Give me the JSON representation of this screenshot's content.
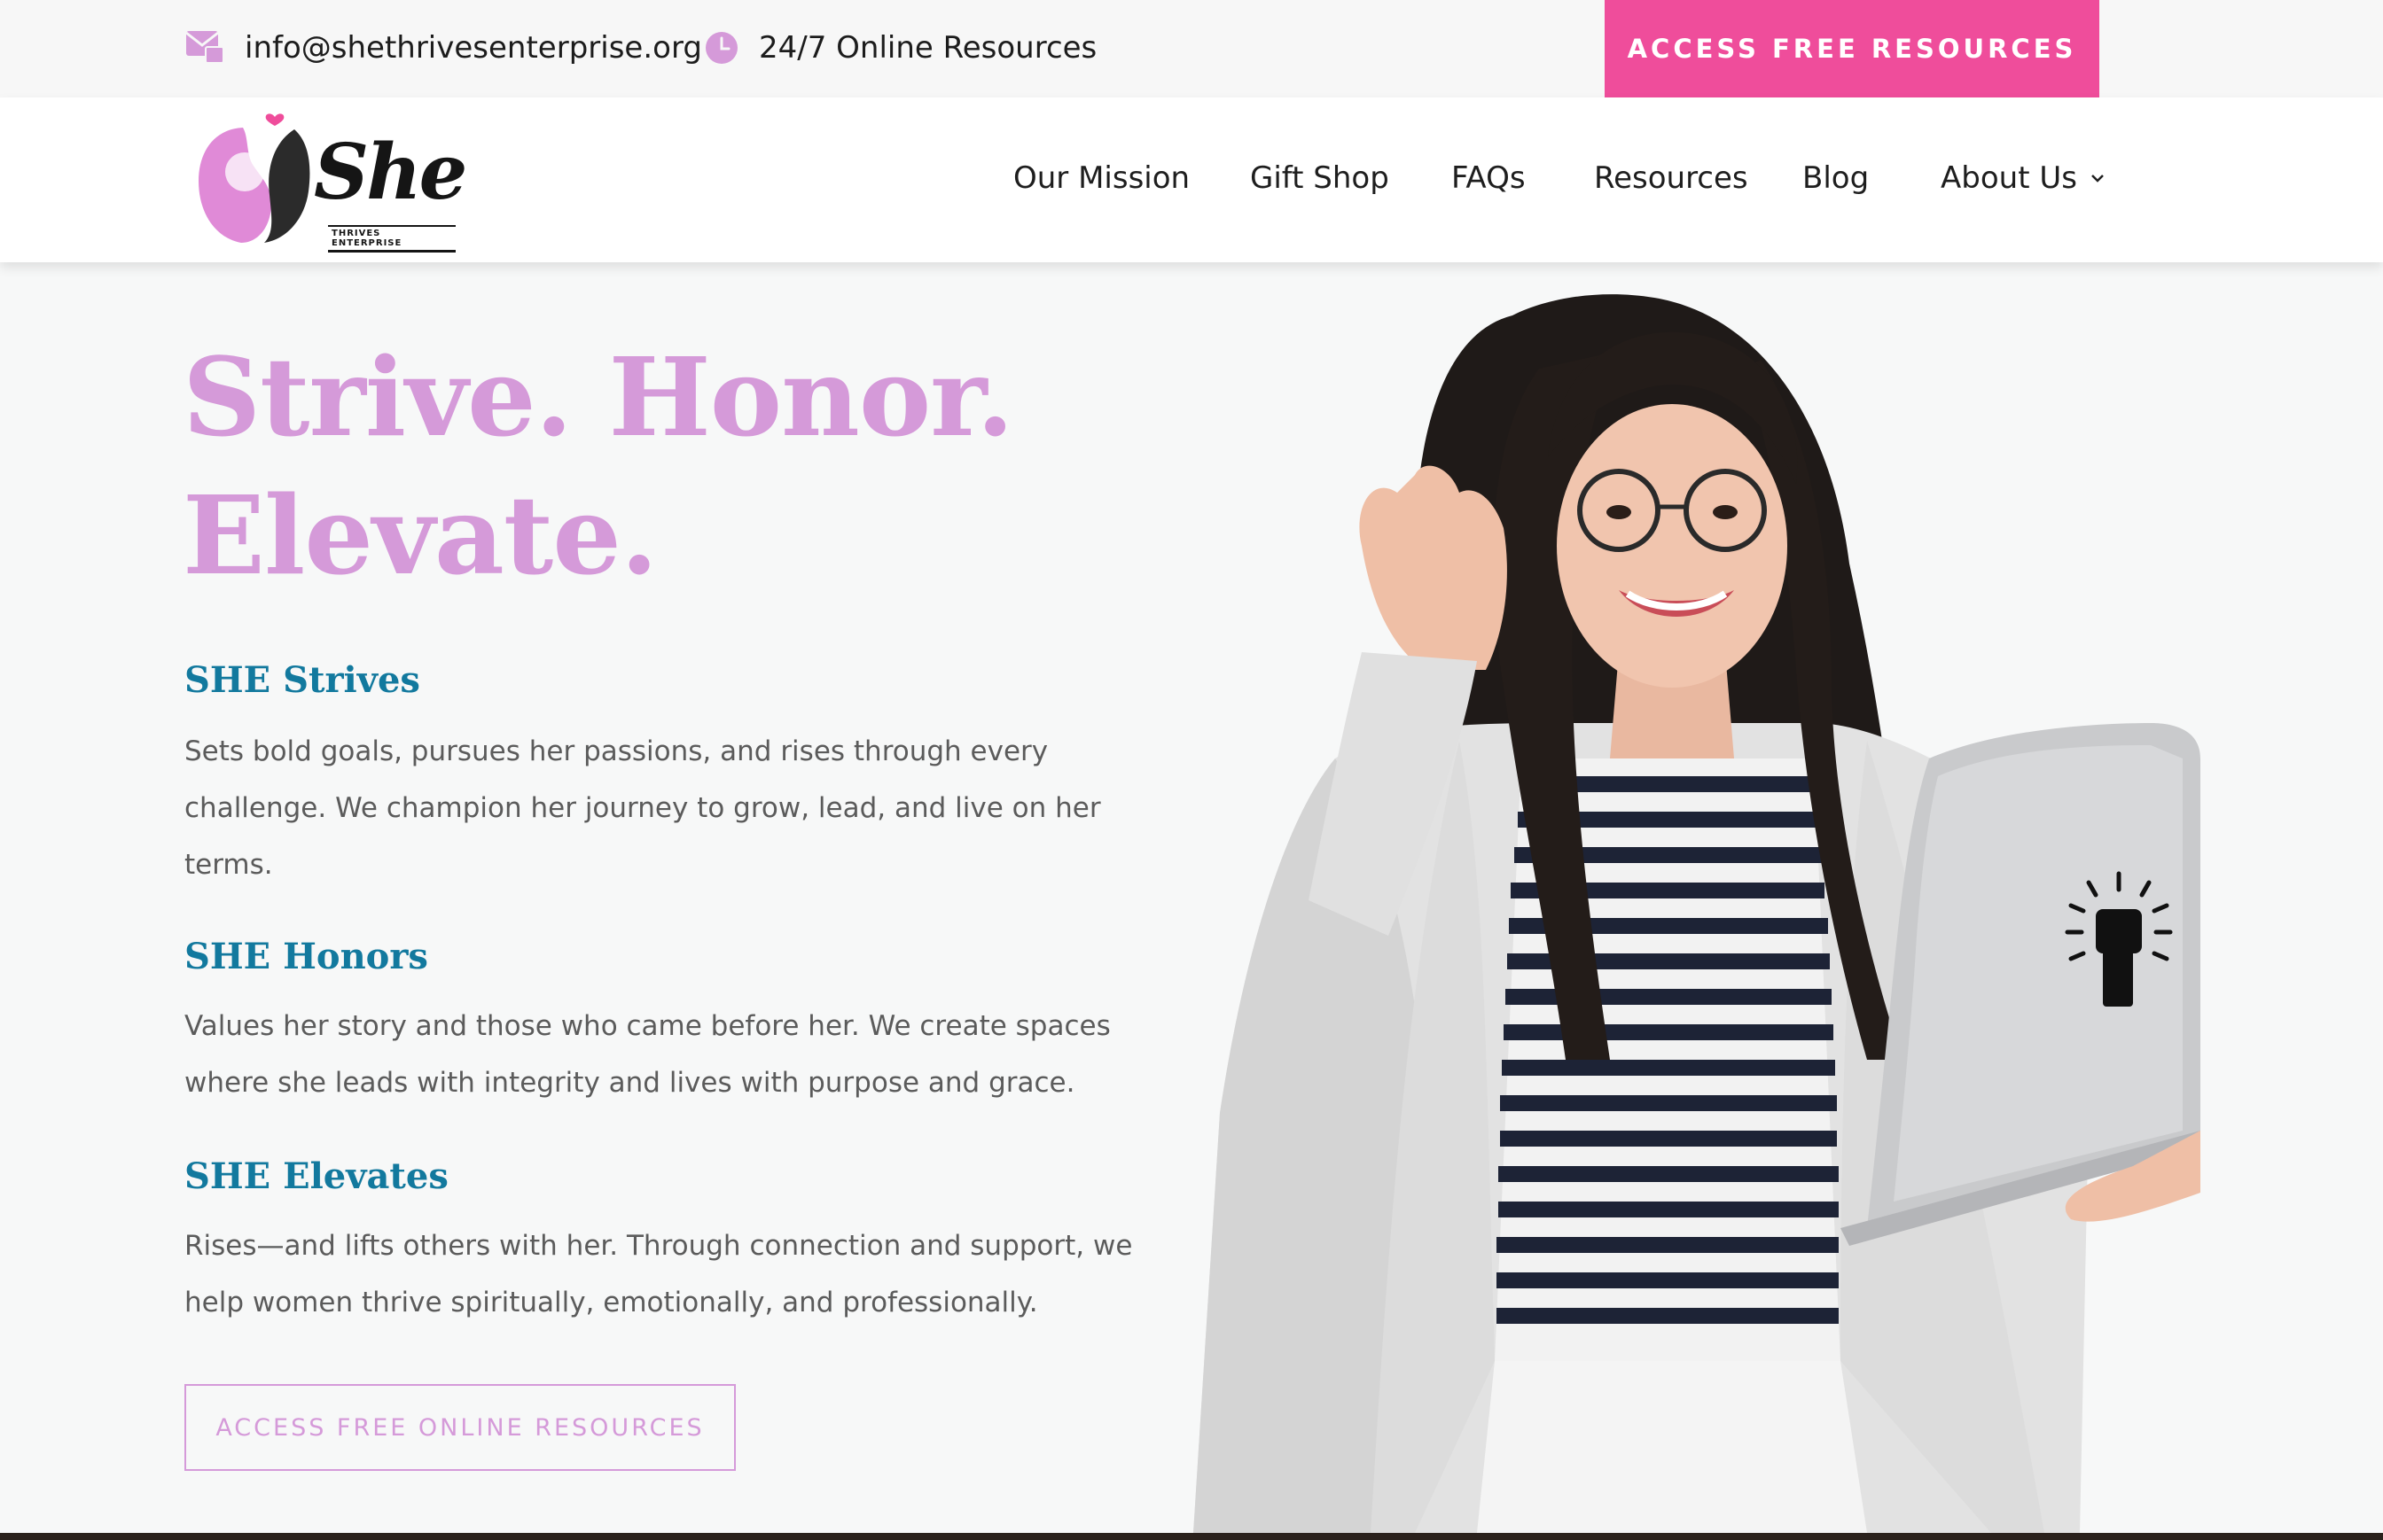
{
  "topbar": {
    "email": "info@shethrivesenterprise.org",
    "hours": "24/7 Online Resources",
    "cta_label": "ACCESS FREE RESOURCES"
  },
  "header": {
    "logo_text": "She",
    "logo_sub": "THRIVES ENTERPRISE",
    "nav": [
      {
        "label": "Our Mission"
      },
      {
        "label": "Gift Shop"
      },
      {
        "label": "FAQs"
      },
      {
        "label": "Resources"
      },
      {
        "label": "Blog"
      },
      {
        "label": "About Us"
      }
    ]
  },
  "hero": {
    "headline_line1": "Strive. Honor.",
    "headline_line2": "Elevate.",
    "sections": [
      {
        "title": "SHE Strives",
        "body": "Sets bold goals, pursues her passions, and rises through every challenge. We champion her journey to grow, lead, and live on her terms."
      },
      {
        "title": "SHE Honors",
        "body": "Values her story and those who came before her. We create spaces where she leads with integrity and lives with purpose and grace."
      },
      {
        "title": "SHE Elevates",
        "body": "Rises—and lifts others with her. Through connection and support, we help women thrive spiritually, emotionally, and professionally."
      }
    ],
    "cta_label": "ACCESS FREE ONLINE RESOURCES"
  },
  "colors": {
    "brand_pink": "#ef4d9b",
    "headline_lilac": "#d59ad9",
    "section_teal": "#12799e"
  }
}
